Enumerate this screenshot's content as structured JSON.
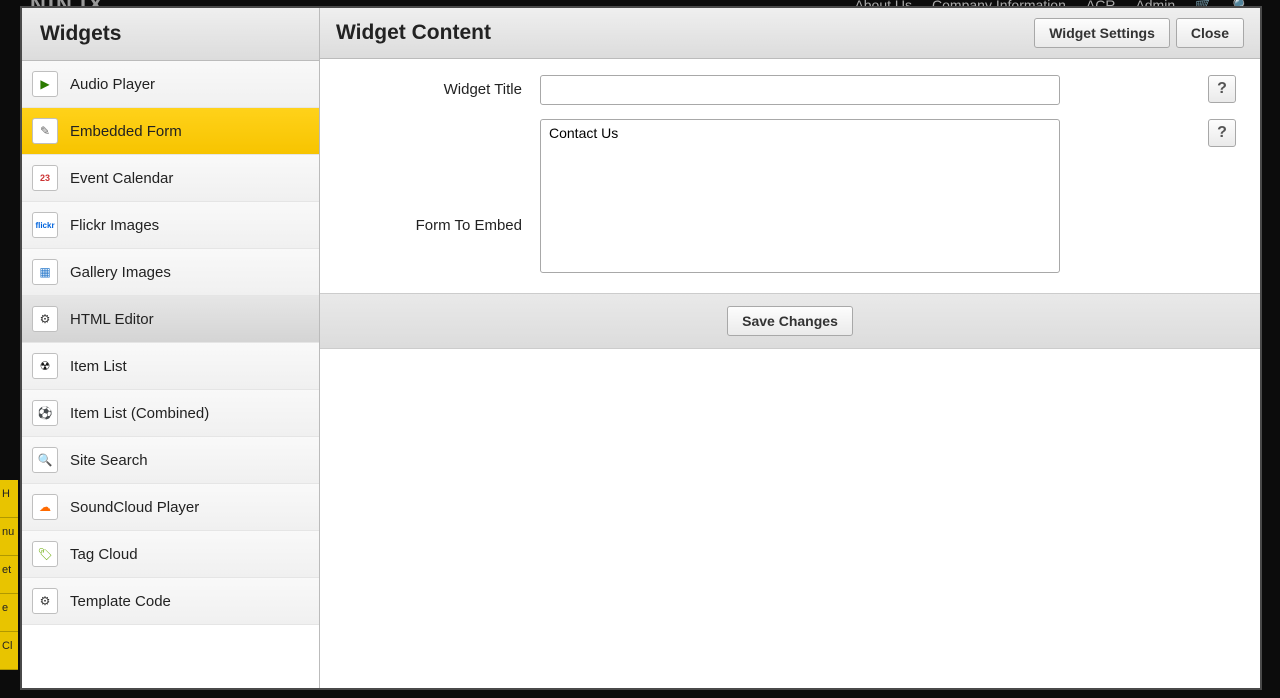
{
  "bg": {
    "logo": "NINJX",
    "nav": [
      "About Us",
      "Company Information",
      "ACR",
      "Admin"
    ],
    "left_stripe": [
      "H",
      "nu",
      "et",
      "e",
      "Cl"
    ]
  },
  "sidebar": {
    "title": "Widgets",
    "items": [
      {
        "label": "Audio Player",
        "icon": "play-icon",
        "state": ""
      },
      {
        "label": "Embedded Form",
        "icon": "form-icon",
        "state": "selected"
      },
      {
        "label": "Event Calendar",
        "icon": "calendar-icon",
        "state": ""
      },
      {
        "label": "Flickr Images",
        "icon": "flickr-icon",
        "state": ""
      },
      {
        "label": "Gallery Images",
        "icon": "gallery-icon",
        "state": ""
      },
      {
        "label": "HTML Editor",
        "icon": "html-icon",
        "state": "hover"
      },
      {
        "label": "Item List",
        "icon": "radio-icon",
        "state": ""
      },
      {
        "label": "Item List (Combined)",
        "icon": "soccer-icon",
        "state": ""
      },
      {
        "label": "Site Search",
        "icon": "search-icon",
        "state": ""
      },
      {
        "label": "SoundCloud Player",
        "icon": "soundcloud-icon",
        "state": ""
      },
      {
        "label": "Tag Cloud",
        "icon": "tag-icon",
        "state": ""
      },
      {
        "label": "Template Code",
        "icon": "template-icon",
        "state": ""
      }
    ]
  },
  "content": {
    "title": "Widget Content",
    "buttons": {
      "settings": "Widget Settings",
      "close": "Close"
    },
    "fields": {
      "widget_title": {
        "label": "Widget Title",
        "value": ""
      },
      "form_to_embed": {
        "label": "Form To Embed",
        "options": [
          "Contact Us"
        ]
      }
    },
    "help": "?",
    "save": "Save Changes"
  },
  "icon_glyphs": {
    "play-icon": "▶",
    "form-icon": "✎",
    "calendar-icon": "23",
    "flickr-icon": "flickr",
    "gallery-icon": "▦",
    "html-icon": "⚙",
    "radio-icon": "☢",
    "soccer-icon": "⚽",
    "search-icon": "🔍",
    "soundcloud-icon": "☁",
    "tag-icon": "🏷",
    "template-icon": "⚙"
  }
}
